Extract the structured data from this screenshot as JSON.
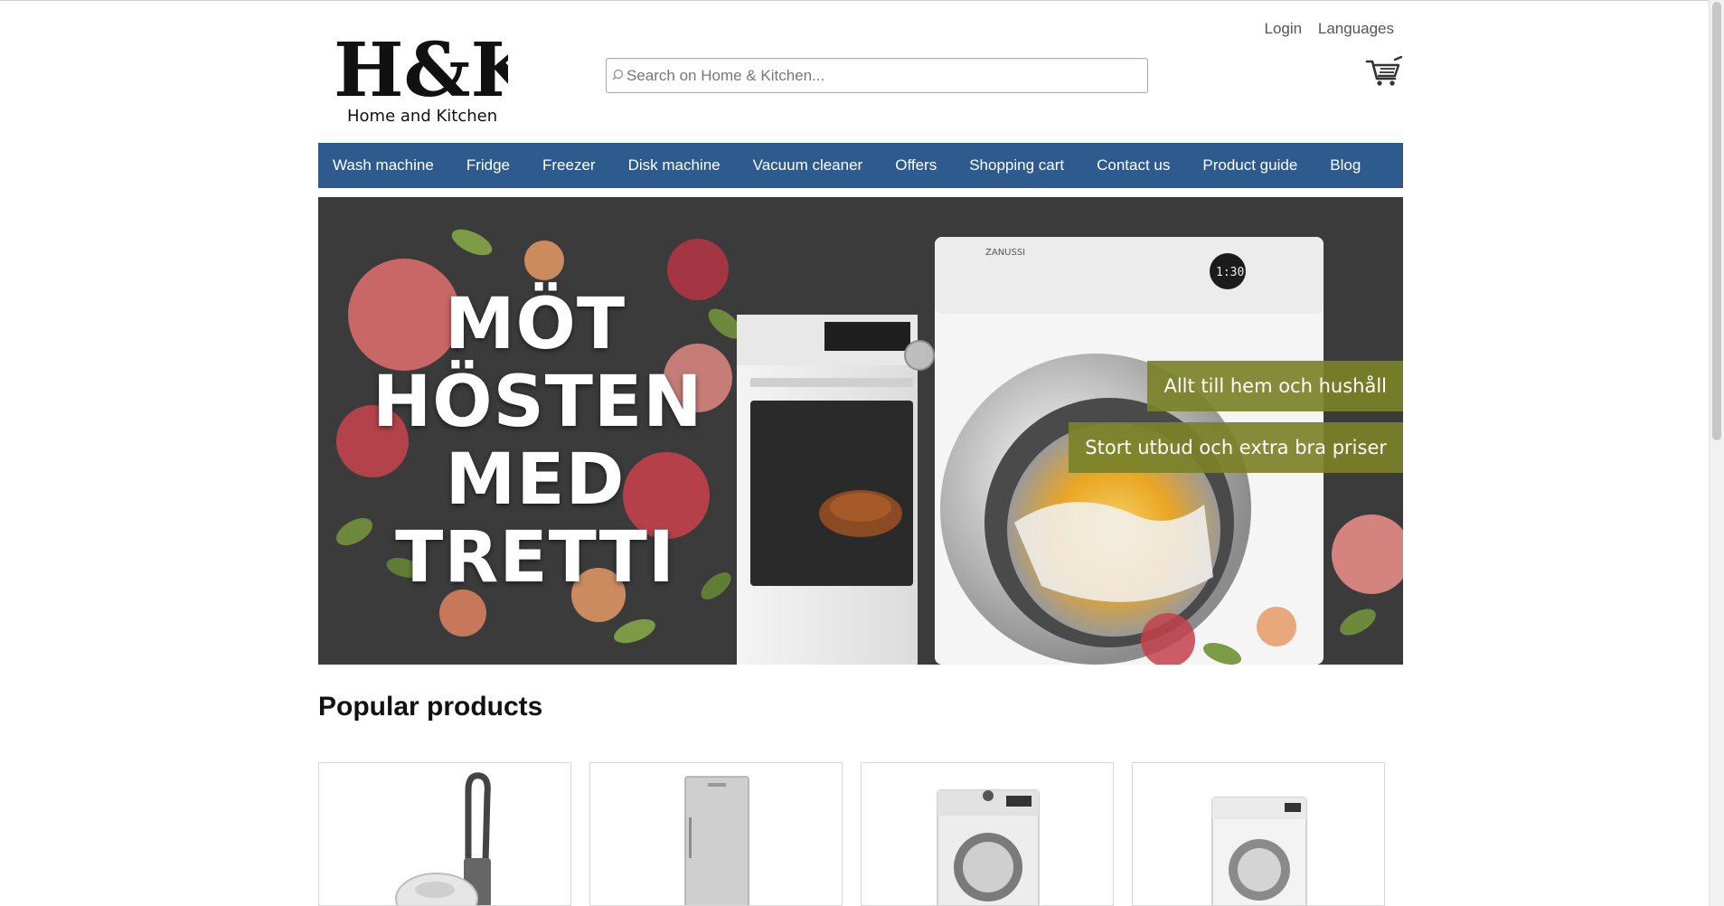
{
  "brand": {
    "logo_text": "H&K",
    "tagline": "Home and Kitchen"
  },
  "search": {
    "placeholder": "Search on Home & Kitchen..."
  },
  "top_links": {
    "login": "Login",
    "languages": "Languages"
  },
  "nav": {
    "items": [
      {
        "label": "Wash machine"
      },
      {
        "label": "Fridge"
      },
      {
        "label": "Freezer"
      },
      {
        "label": "Disk machine"
      },
      {
        "label": "Vacuum cleaner"
      },
      {
        "label": "Offers"
      },
      {
        "label": "Shopping cart"
      },
      {
        "label": "Contact us"
      },
      {
        "label": "Product guide"
      },
      {
        "label": "Blog"
      }
    ]
  },
  "hero": {
    "title_lines": [
      "MÖT",
      "HÖSTEN",
      "MED",
      "TRETTI"
    ],
    "tagline_1": "Allt till hem och hushåll",
    "tagline_2": "Stort utbud och extra bra priser",
    "washer_brand": "ZANUSSI",
    "washer_display": "1:30"
  },
  "popular": {
    "title": "Popular products",
    "products": [
      {
        "icon": "vacuum-cleaner-icon"
      },
      {
        "icon": "fridge-icon"
      },
      {
        "icon": "washing-machine-icon"
      },
      {
        "icon": "washing-machine-icon"
      }
    ]
  },
  "colors": {
    "nav": "#2e5a8e",
    "tag": "#7a8228",
    "hero_bg": "#3b3b3b"
  }
}
